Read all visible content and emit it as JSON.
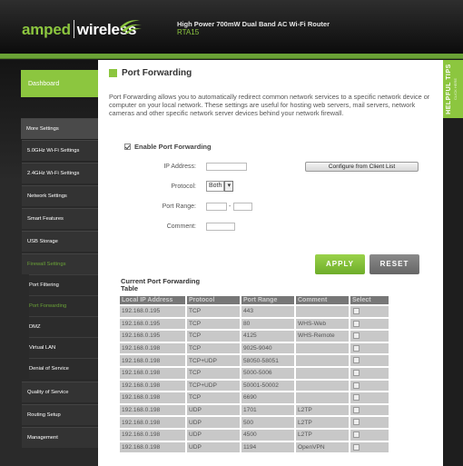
{
  "header": {
    "logo_part1": "amped",
    "logo_part2": "wireless",
    "product_line": "High Power 700mW Dual Band AC Wi-Fi Router",
    "model": "RTA15"
  },
  "colors": {
    "brand_green": "#8cc63f",
    "active_green": "#6aa236"
  },
  "helpful_tips": {
    "title": "HELPFUL TIPS",
    "subtitle": "CLICK HERE"
  },
  "sidebar": {
    "dashboard": "Dashboard",
    "items": [
      {
        "label": "More Settings",
        "type": "head"
      },
      {
        "label": "5.0GHz Wi-Fi Settings",
        "type": "item"
      },
      {
        "label": "2.4GHz Wi-Fi Settings",
        "type": "item"
      },
      {
        "label": "Network Settings",
        "type": "item"
      },
      {
        "label": "Smart Features",
        "type": "item"
      },
      {
        "label": "USB Storage",
        "type": "item"
      },
      {
        "label": "Firewall Settings",
        "type": "item",
        "active": true
      },
      {
        "label": "Port Filtering",
        "type": "sub"
      },
      {
        "label": "Port Forwarding",
        "type": "sub",
        "active": true
      },
      {
        "label": "DMZ",
        "type": "sub"
      },
      {
        "label": "Virtual LAN",
        "type": "sub"
      },
      {
        "label": "Denial of Service",
        "type": "sub"
      },
      {
        "label": "Quality of Service",
        "type": "item"
      },
      {
        "label": "Routing Setup",
        "type": "item"
      },
      {
        "label": "Management",
        "type": "item"
      }
    ]
  },
  "main": {
    "title": "Port Forwarding",
    "description": "Port Forwarding allows you to automatically redirect common network services to a specific network device or computer on your local network. These settings are useful for hosting web servers, mail servers, network cameras and other specific network server devices behind your network firewall.",
    "enable_label": "Enable Port Forwarding",
    "enable_checked": true,
    "form": {
      "ip_label": "IP Address:",
      "ip_value": "",
      "protocol_label": "Protocol:",
      "protocol_value": "Both",
      "port_range_label": "Port Range:",
      "port_from": "",
      "port_to": "",
      "port_sep": "-",
      "comment_label": "Comment:",
      "comment_value": "",
      "configure_button": "Configure from Client List"
    },
    "apply_button": "APPLY",
    "reset_button": "RESET",
    "table": {
      "title": "Current Port Forwarding Table",
      "headers": [
        "Local IP Address",
        "Protocol",
        "Port Range",
        "Comment",
        "Select"
      ],
      "rows": [
        [
          "192.168.0.195",
          "TCP",
          "443",
          ""
        ],
        [
          "192.168.0.195",
          "TCP",
          "80",
          "WHS-Web"
        ],
        [
          "192.168.0.195",
          "TCP",
          "4125",
          "WHS-Remote"
        ],
        [
          "192.168.0.198",
          "TCP",
          "9025-9040",
          ""
        ],
        [
          "192.168.0.198",
          "TCP+UDP",
          "58050-58051",
          ""
        ],
        [
          "192.168.0.198",
          "TCP",
          "5000-5006",
          ""
        ],
        [
          "192.168.0.198",
          "TCP+UDP",
          "50001-50002",
          ""
        ],
        [
          "192.168.0.198",
          "TCP",
          "6690",
          ""
        ],
        [
          "192.168.0.198",
          "UDP",
          "1701",
          "L2TP"
        ],
        [
          "192.168.0.198",
          "UDP",
          "500",
          "L2TP"
        ],
        [
          "192.168.0.198",
          "UDP",
          "4500",
          "L2TP"
        ],
        [
          "192.168.0.198",
          "UDP",
          "1194",
          "OpenVPN"
        ]
      ]
    }
  }
}
